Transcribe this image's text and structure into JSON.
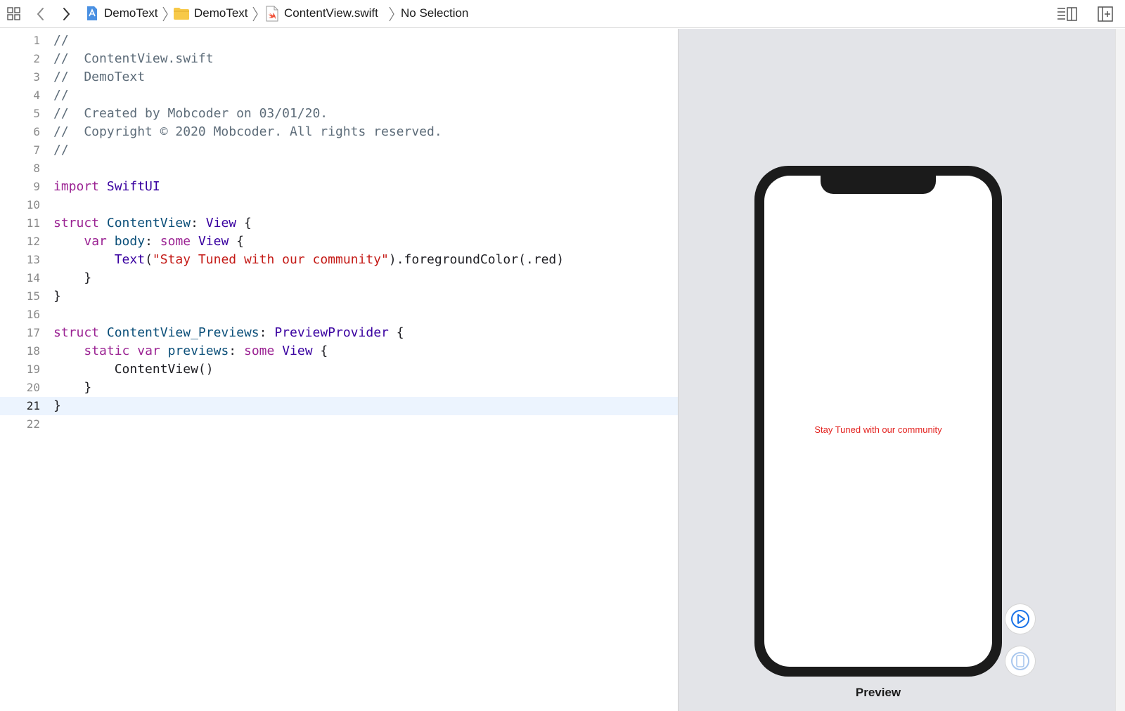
{
  "breadcrumb": {
    "project": "DemoText",
    "folder": "DemoText",
    "file": "ContentView.swift",
    "selection": "No Selection"
  },
  "editor": {
    "current_line": 21,
    "lines": [
      {
        "n": "1",
        "t": "//"
      },
      {
        "n": "2",
        "t": "//  ContentView.swift"
      },
      {
        "n": "3",
        "t": "//  DemoText"
      },
      {
        "n": "4",
        "t": "//"
      },
      {
        "n": "5",
        "t": "//  Created by Mobcoder on 03/01/20."
      },
      {
        "n": "6",
        "t": "//  Copyright © 2020 Mobcoder. All rights reserved."
      },
      {
        "n": "7",
        "t": "//"
      },
      {
        "n": "8",
        "t": ""
      },
      {
        "n": "9",
        "t": "import SwiftUI"
      },
      {
        "n": "10",
        "t": ""
      },
      {
        "n": "11",
        "t": "struct ContentView: View {"
      },
      {
        "n": "12",
        "t": "    var body: some View {"
      },
      {
        "n": "13",
        "t": "        Text(\"Stay Tuned with our community\").foregroundColor(.red)"
      },
      {
        "n": "14",
        "t": "    }"
      },
      {
        "n": "15",
        "t": "}"
      },
      {
        "n": "16",
        "t": ""
      },
      {
        "n": "17",
        "t": "struct ContentView_Previews: PreviewProvider {"
      },
      {
        "n": "18",
        "t": "    static var previews: some View {"
      },
      {
        "n": "19",
        "t": "        ContentView()"
      },
      {
        "n": "20",
        "t": "    }"
      },
      {
        "n": "21",
        "t": "}"
      },
      {
        "n": "22",
        "t": ""
      }
    ]
  },
  "preview": {
    "text": "Stay Tuned with our community",
    "label": "Preview"
  },
  "colors": {
    "keyword": "#9b2393",
    "comment": "#5d6c79",
    "string": "#c41a16",
    "preview_text": "#e3211e",
    "accent": "#1a73e8"
  },
  "icons": {
    "related_items": "grid-icon",
    "back": "chevron-left-icon",
    "forward": "chevron-right-icon",
    "project": "xcode-project-icon",
    "folder": "folder-icon",
    "swift_file": "swift-file-icon",
    "editor_options": "editor-options-icon",
    "add_editor": "add-editor-icon",
    "live_preview": "play-circle-icon",
    "preview_on_device": "device-icon"
  }
}
